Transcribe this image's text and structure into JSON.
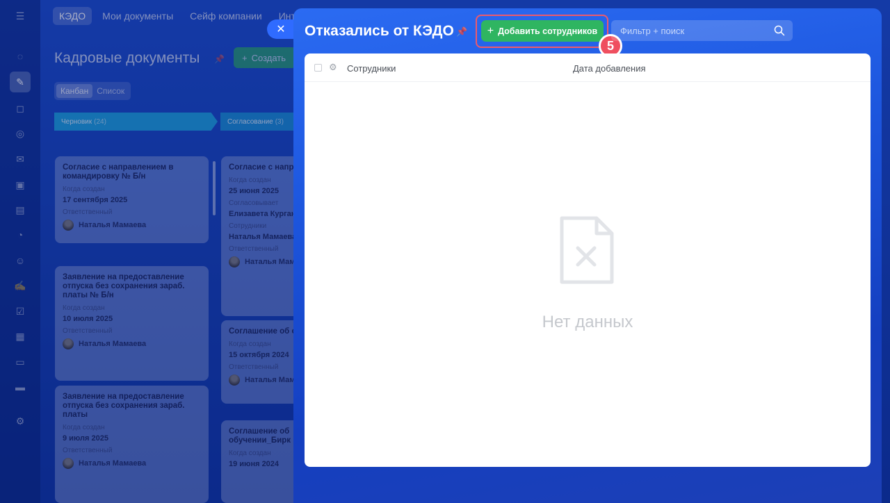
{
  "background": {
    "tabs": [
      "КЭДО",
      "Мои документы",
      "Сейф компании",
      "Интегр"
    ],
    "page_title": "Кадровые документы",
    "create_label": "Создать",
    "view_options": [
      "Канбан",
      "Список"
    ],
    "stages": [
      {
        "name": "Черновик",
        "count": "(24)"
      },
      {
        "name": "Согласование",
        "count": "(3)"
      }
    ],
    "cards_col1": [
      {
        "title": "Согласие с направлением в командировку № Б/н",
        "created_label": "Когда создан",
        "created": "17 сентября 2025",
        "resp_label": "Ответственный",
        "resp": "Наталья Мамаева"
      },
      {
        "title": "Заявление на предоставление отпуска без сохранения зараб. платы № Б/н",
        "created_label": "Когда создан",
        "created": "10 июля 2025",
        "resp_label": "Ответственный",
        "resp": "Наталья Мамаева"
      },
      {
        "title": "Заявление на предоставление отпуска без сохранения зараб. платы",
        "created_label": "Когда создан",
        "created": "9 июля 2025",
        "resp_label": "Ответственный",
        "resp": "Наталья Мамаева"
      }
    ],
    "cards_col2": [
      {
        "title": "Согласие с напра",
        "created_label": "Когда создан",
        "created": "25 июня 2025",
        "agree_label": "Согласовывает",
        "agree": "Елизавета Курган",
        "emp_label": "Сотрудники",
        "emp": "Наталья Мамаева",
        "resp_label": "Ответственный",
        "resp": "Наталья Мама"
      },
      {
        "title": "Соглашение об о",
        "created_label": "Когда создан",
        "created": "15 октября 2024",
        "resp_label": "Ответственный",
        "resp": "Наталья Мама"
      },
      {
        "title": "Соглашение об обучении_Бирк",
        "created_label": "Когда создан",
        "created": "19 июня 2024"
      }
    ]
  },
  "panel": {
    "title": "Отказались от КЭДО",
    "add_button": "Добавить сотрудников",
    "step_number": "5",
    "search_placeholder": "Фильтр + поиск",
    "columns": [
      "Сотрудники",
      "Дата добавления"
    ],
    "empty_text": "Нет данных"
  },
  "colors": {
    "accent_green": "#2fb561",
    "highlight_red": "#ef5a6a",
    "panel_blue": "#1c55dd"
  }
}
